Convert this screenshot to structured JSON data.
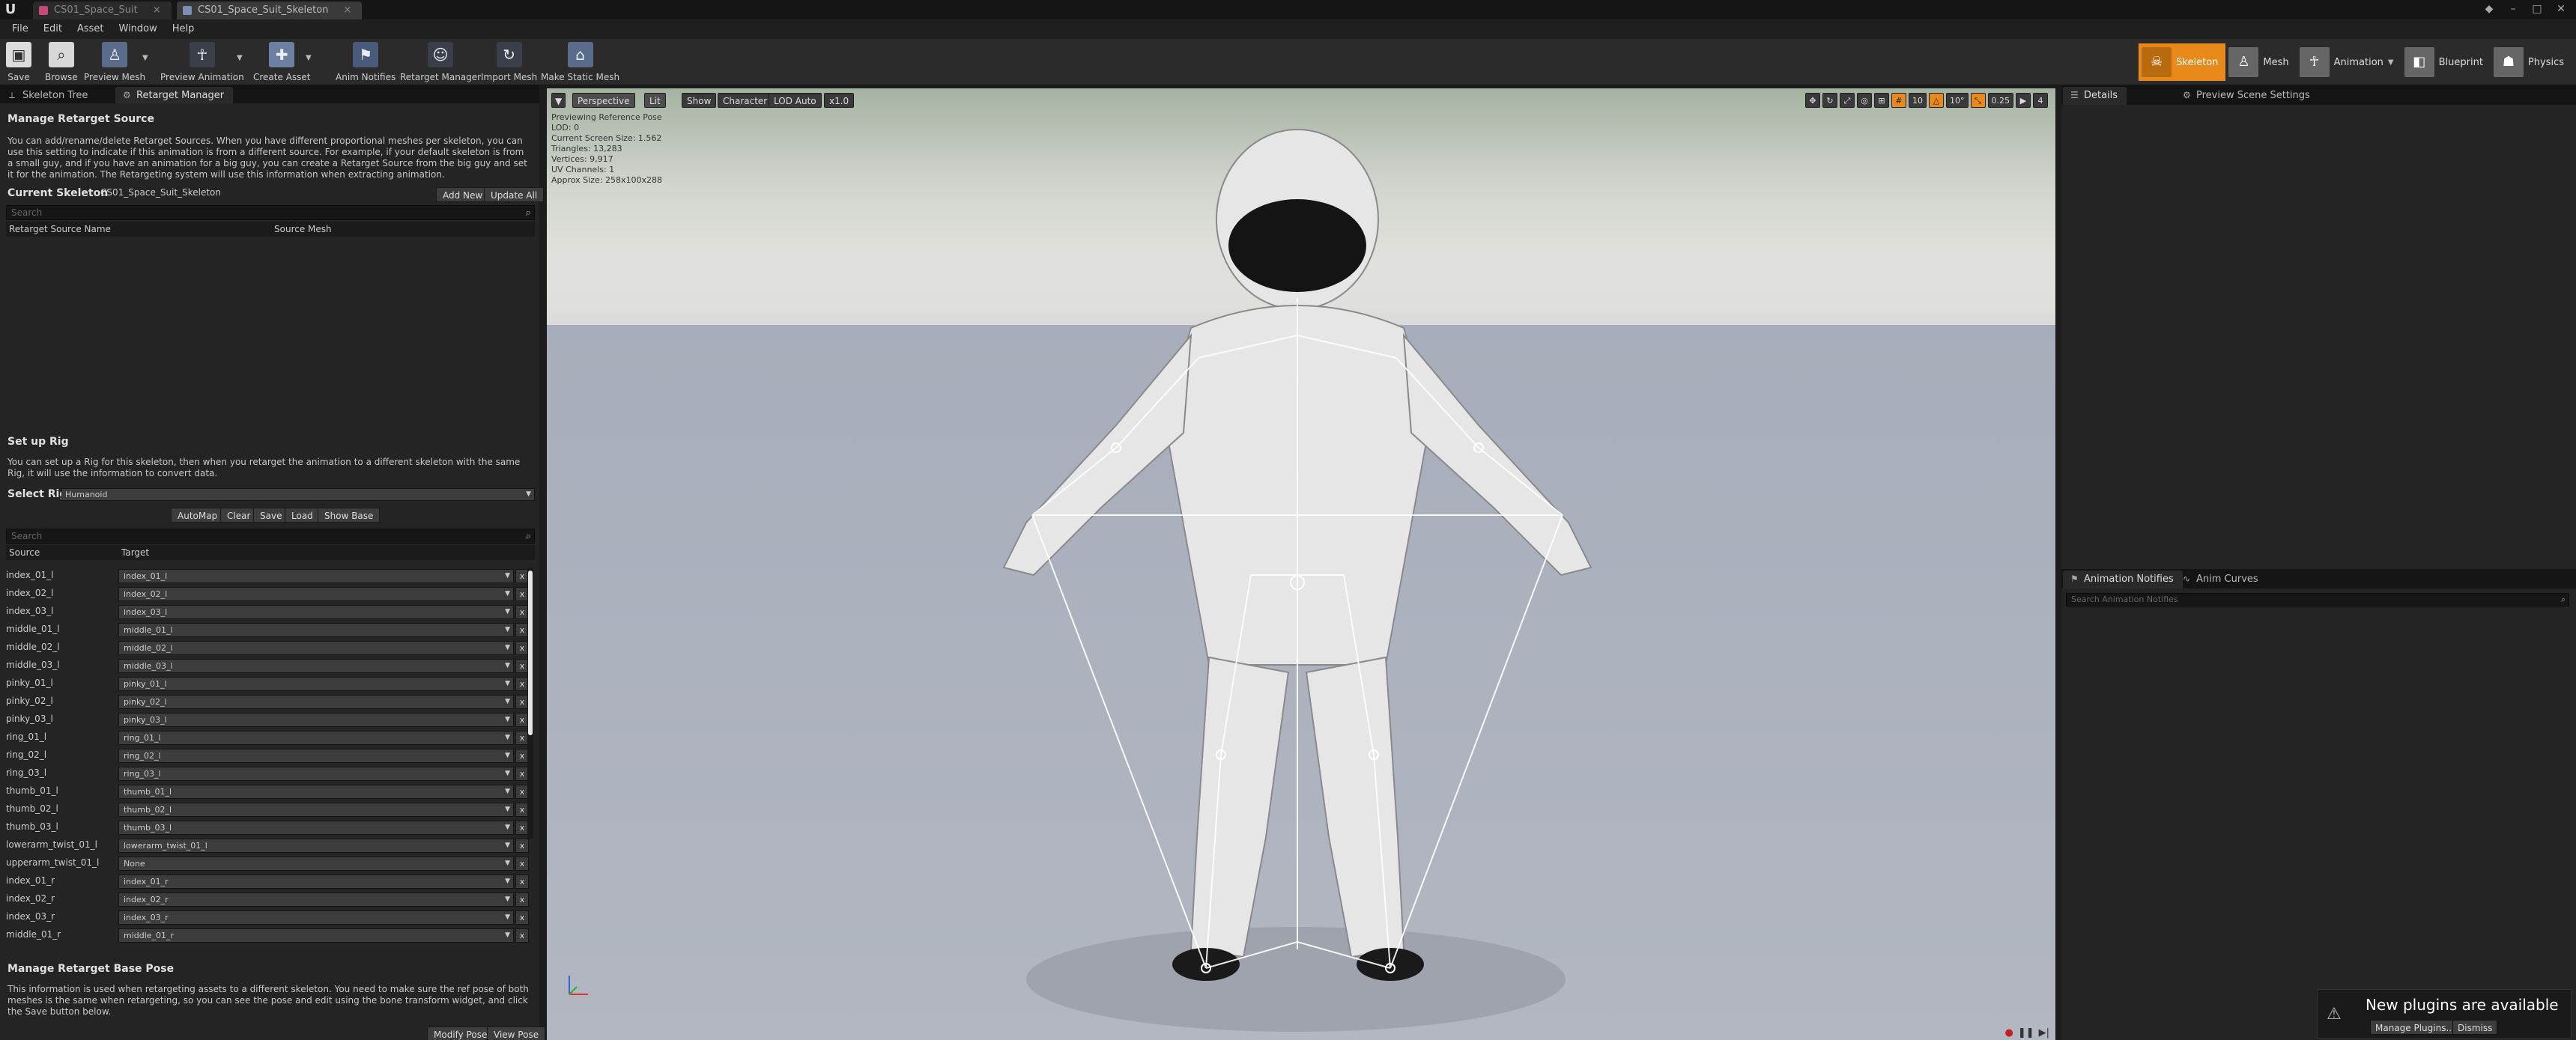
{
  "titlebar": {
    "app_logo": "U",
    "tabs": [
      {
        "label": "CS01_Space_Suit",
        "active": false
      },
      {
        "label": "CS01_Space_Suit_Skeleton",
        "active": true
      }
    ]
  },
  "menu": [
    "File",
    "Edit",
    "Asset",
    "Window",
    "Help"
  ],
  "toolbar": {
    "buttons": [
      "Save",
      "Browse",
      "Preview Mesh",
      "Preview Animation",
      "Create Asset",
      "Anim Notifies",
      "Retarget Manager",
      "Import Mesh",
      "Make Static Mesh"
    ],
    "modes": [
      "Skeleton",
      "Mesh",
      "Animation",
      "Blueprint",
      "Physics"
    ]
  },
  "left_tabs": [
    "Skeleton Tree",
    "Retarget Manager"
  ],
  "retarget_source": {
    "title": "Manage Retarget Source",
    "description": "You can add/rename/delete Retarget Sources. When you have different proportional meshes per skeleton, you can use this setting to indicate if this animation is from a different source. For example, if your default skeleton is from a small guy, and if you have an animation for a big guy, you can create a Retarget Source from the big guy and set it for the animation. The Retargeting system will use this information when extracting animation.",
    "current_skeleton_label": "Current Skeleton",
    "current_skeleton_value": "CS01_Space_Suit_Skeleton",
    "add_new": "Add New",
    "update_all": "Update All",
    "search_placeholder": "Search",
    "col_name": "Retarget Source Name",
    "col_mesh": "Source Mesh"
  },
  "rig": {
    "title": "Set up Rig",
    "description": "You can set up a Rig for this skeleton, then when you retarget the animation to a different skeleton with the same Rig, it will use the information to convert data.",
    "select_rig_label": "Select Rig",
    "select_rig_value": "Humanoid",
    "buttons": [
      "AutoMap",
      "Clear",
      "Save",
      "Load",
      "Show Base"
    ],
    "search_placeholder": "Search",
    "col_source": "Source",
    "col_target": "Target",
    "remove_glyph": "x",
    "rows": [
      {
        "source": "index_01_l",
        "target": "index_01_l"
      },
      {
        "source": "index_02_l",
        "target": "index_02_l"
      },
      {
        "source": "index_03_l",
        "target": "index_03_l"
      },
      {
        "source": "middle_01_l",
        "target": "middle_01_l"
      },
      {
        "source": "middle_02_l",
        "target": "middle_02_l"
      },
      {
        "source": "middle_03_l",
        "target": "middle_03_l"
      },
      {
        "source": "pinky_01_l",
        "target": "pinky_01_l"
      },
      {
        "source": "pinky_02_l",
        "target": "pinky_02_l"
      },
      {
        "source": "pinky_03_l",
        "target": "pinky_03_l"
      },
      {
        "source": "ring_01_l",
        "target": "ring_01_l"
      },
      {
        "source": "ring_02_l",
        "target": "ring_02_l"
      },
      {
        "source": "ring_03_l",
        "target": "ring_03_l"
      },
      {
        "source": "thumb_01_l",
        "target": "thumb_01_l"
      },
      {
        "source": "thumb_02_l",
        "target": "thumb_02_l"
      },
      {
        "source": "thumb_03_l",
        "target": "thumb_03_l"
      },
      {
        "source": "lowerarm_twist_01_l",
        "target": "lowerarm_twist_01_l"
      },
      {
        "source": "upperarm_twist_01_l",
        "target": "None"
      },
      {
        "source": "index_01_r",
        "target": "index_01_r"
      },
      {
        "source": "index_02_r",
        "target": "index_02_r"
      },
      {
        "source": "index_03_r",
        "target": "index_03_r"
      },
      {
        "source": "middle_01_r",
        "target": "middle_01_r"
      }
    ]
  },
  "base_pose": {
    "title": "Manage Retarget Base Pose",
    "description": "This information is used when retargeting assets to a different skeleton. You need to make sure the ref pose of both meshes is the same when retargeting, so you can see the pose and edit using the bone transform widget, and click the Save button below.",
    "modify_pose": "Modify Pose",
    "view_pose": "View Pose"
  },
  "viewport": {
    "buttons": [
      "Perspective",
      "Lit",
      "Show",
      "Character",
      "LOD Auto",
      "x1.0"
    ],
    "info": [
      "Previewing Reference Pose",
      "LOD: 0",
      "Current Screen Size: 1.562",
      "Triangles: 13,283",
      "Vertices: 9,917",
      "UV Channels: 1",
      "Approx Size: 258x100x288"
    ],
    "right_controls": [
      "10",
      "10°",
      "0.25",
      "4"
    ]
  },
  "right_tabs_top": [
    "Details",
    "Preview Scene Settings"
  ],
  "right_tabs_bottom": [
    "Animation Notifies",
    "Anim Curves"
  ],
  "anim_search_placeholder": "Search Animation Notifies",
  "notification": {
    "message": "New plugins are available",
    "manage": "Manage Plugins...",
    "dismiss": "Dismiss"
  }
}
